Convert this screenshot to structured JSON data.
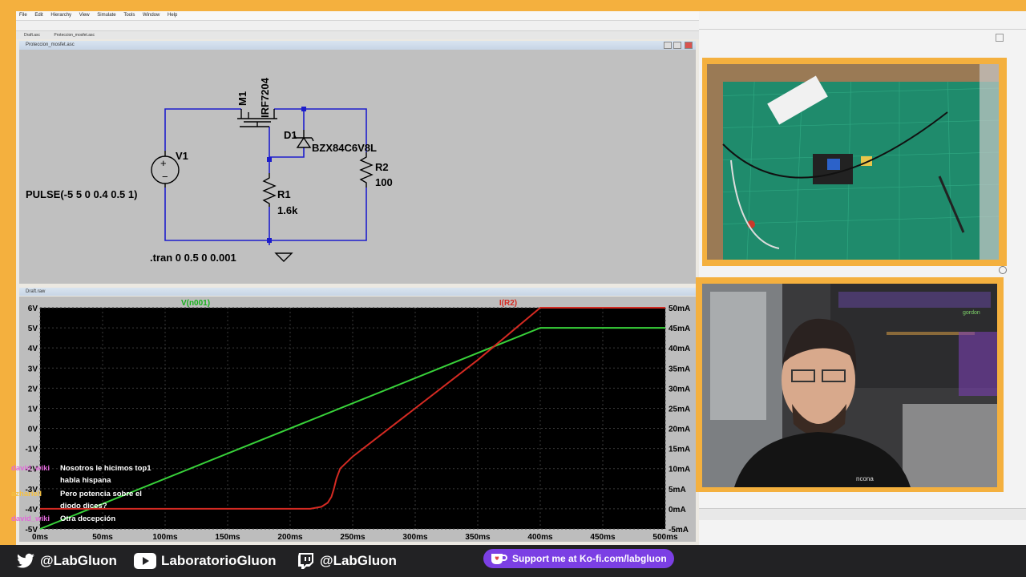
{
  "ltspice": {
    "menu": [
      "File",
      "Edit",
      "Hierarchy",
      "View",
      "Simulate",
      "Tools",
      "Window",
      "Help"
    ],
    "tabs": [
      "Draft.asc",
      "Proteccion_mosfet.asc"
    ],
    "schematic_title": "Proteccion_mosfet.asc",
    "waveform_title": "Draft.raw"
  },
  "schematic": {
    "m1_name": "M1",
    "m1_model": "IRF7204",
    "d1_name": "D1",
    "d1_model": "BZX84C6V8L",
    "v1_name": "V1",
    "v1_value": "PULSE(-5 5 0 0.4 0.5 1)",
    "r1_name": "R1",
    "r1_value": "1.6k",
    "r2_name": "R2",
    "r2_value": "100",
    "directive": ".tran 0 0.5 0 0.001"
  },
  "chart_data": {
    "type": "line",
    "title": "",
    "x_unit": "ms",
    "x_ticks": [
      "0ms",
      "50ms",
      "100ms",
      "150ms",
      "200ms",
      "250ms",
      "300ms",
      "350ms",
      "400ms",
      "450ms",
      "500ms"
    ],
    "xlim": [
      0,
      500
    ],
    "y_left_ticks": [
      "6V",
      "5V",
      "4V",
      "3V",
      "2V",
      "1V",
      "0V",
      "-1V",
      "-2V",
      "-3V",
      "-4V",
      "-5V"
    ],
    "ylim_left": [
      -5,
      6
    ],
    "y_right_ticks": [
      "50mA",
      "45mA",
      "40mA",
      "35mA",
      "30mA",
      "25mA",
      "20mA",
      "15mA",
      "10mA",
      "5mA",
      "0mA",
      "-5mA"
    ],
    "ylim_right": [
      -5,
      50
    ],
    "series": [
      {
        "name": "V(n001)",
        "axis": "left",
        "color": "#38d23a",
        "x": [
          0,
          400,
          500
        ],
        "y": [
          -5,
          5,
          5
        ]
      },
      {
        "name": "I(R2)",
        "axis": "right",
        "color": "#d42a22",
        "x": [
          0,
          216,
          225,
          230,
          233,
          235,
          237,
          240,
          250,
          300,
          350,
          400,
          500
        ],
        "y": [
          0,
          0,
          0.5,
          1.5,
          3,
          5,
          7.5,
          10,
          13,
          25,
          37,
          50,
          50
        ]
      }
    ]
  },
  "chat": [
    {
      "user": "david_wiki",
      "user_color": "#e069d8",
      "lines": [
        "Nosotros le hicimos top1",
        "habla hispana"
      ]
    },
    {
      "user": "azhariell",
      "user_color": "#f5c143",
      "lines": [
        "Pero potencia sobre el",
        "diodo dices?"
      ]
    },
    {
      "user": "david_wiki",
      "user_color": "#e069d8",
      "lines": [
        "Otra decepción"
      ]
    }
  ],
  "camera": {
    "shirt_text": "ncona",
    "shelf_tag": "gordon"
  },
  "footer": {
    "twitter": "@LabGluon",
    "youtube": "LaboratorioGluon",
    "twitch": "@LabGluon",
    "kofi": "Support me at Ko-fi.com/labgluon"
  },
  "colors": {
    "frame": "#f4b03e",
    "wire": "#1d1dcc",
    "chart_bg": "#000000",
    "kofi": "#7b3fe4"
  }
}
